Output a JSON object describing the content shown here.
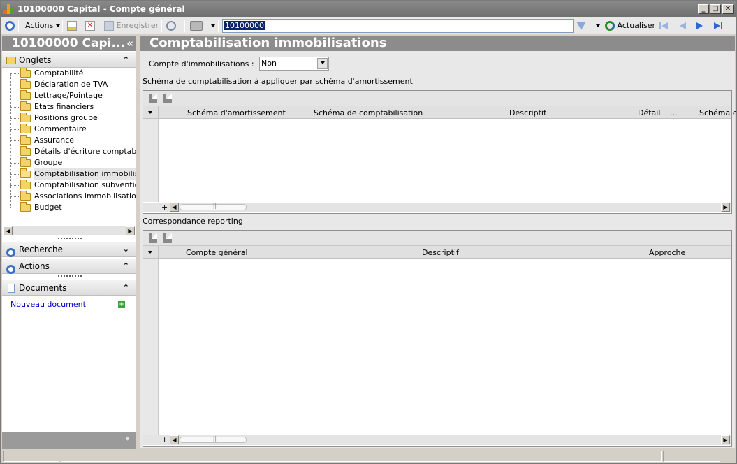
{
  "window": {
    "title": "10100000 Capital - Compte général"
  },
  "toolbar": {
    "actions_label": "Actions",
    "save_label": "Enregistrer",
    "record_value": "10100000",
    "refresh_label": "Actualiser"
  },
  "left_panel": {
    "title": "10100000 Capi...",
    "tabs_header": "Onglets",
    "tabs": [
      {
        "label": "Comptabilité"
      },
      {
        "label": "Déclaration de TVA"
      },
      {
        "label": "Lettrage/Pointage"
      },
      {
        "label": "Etats financiers"
      },
      {
        "label": "Positions groupe"
      },
      {
        "label": "Commentaire"
      },
      {
        "label": "Assurance"
      },
      {
        "label": "Détails d'écriture comptable"
      },
      {
        "label": "Groupe"
      },
      {
        "label": "Comptabilisation immobilisations"
      },
      {
        "label": "Comptabilisation subventions"
      },
      {
        "label": "Associations immobilisations"
      },
      {
        "label": "Budget"
      }
    ],
    "selected_tab": "Comptabilisation immobilisations",
    "search_header": "Recherche",
    "actions_header": "Actions",
    "documents_header": "Documents",
    "new_document_label": "Nouveau document"
  },
  "main": {
    "title": "Comptabilisation immobilisations",
    "field_label": "Compte d'immobilisations :",
    "field_value": "Non",
    "group1_label": "Schéma de comptabilisation à appliquer par schéma d'amortissement",
    "grid1_columns": [
      "Schéma d'amortissement",
      "Schéma de comptabilisation",
      "Descriptif",
      "Détail",
      "...",
      "Schéma c"
    ],
    "group2_label": "Correspondance reporting",
    "grid2_columns": [
      "Compte général",
      "Descriptif",
      "Approche"
    ]
  },
  "colors": {
    "header_grey": "#8c8c8c",
    "link_blue": "#0000cc",
    "accent_blue": "#3a6fc4"
  }
}
